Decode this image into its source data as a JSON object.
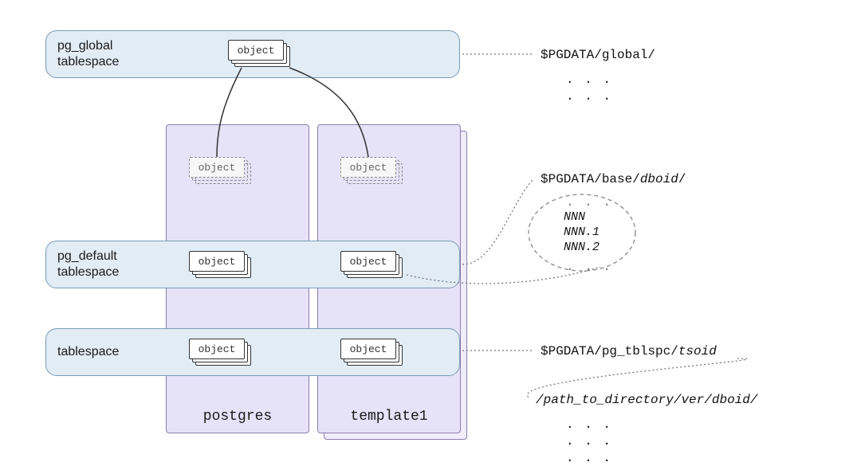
{
  "tablespaces": {
    "global": {
      "label": "pg_global\ntablespace"
    },
    "default": {
      "label": "pg_default\ntablespace"
    },
    "user": {
      "label": "tablespace"
    }
  },
  "databases": {
    "postgres": {
      "label": "postgres"
    },
    "template1": {
      "label": "template1"
    }
  },
  "object_label": "object",
  "paths": {
    "global": {
      "prefix": "$PGDATA/global/",
      "suffix": ""
    },
    "base": {
      "prefix": "$PGDATA/base/",
      "suffix_italic": "dboid",
      "trail": "/"
    },
    "tblspc": {
      "prefix": "$PGDATA/pg_tblspc/",
      "suffix_italic": "tsoid"
    },
    "symlink": {
      "prefix": "/",
      "mid1_italic": "path_to_directory",
      "sep1": "/",
      "mid2_italic": "ver",
      "sep2": "/",
      "mid3_italic": "dboid",
      "trail": "/"
    }
  },
  "file_names": {
    "n0": "NNN",
    "n1": "NNN.1",
    "n2": "NNN.2"
  },
  "ellipsis": ". . ."
}
